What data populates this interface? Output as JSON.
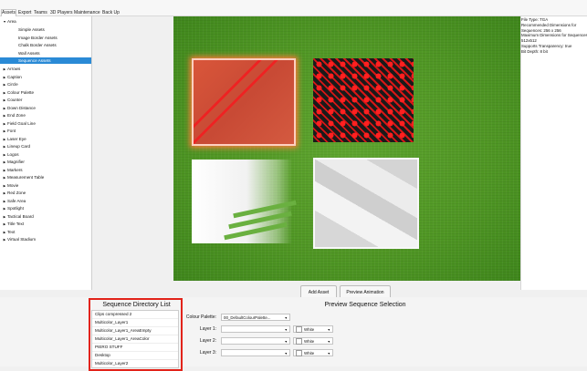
{
  "menu": [
    "Assets",
    "Export",
    "Teams",
    "3D Players",
    "Maintenance",
    "Back Up"
  ],
  "tree": [
    {
      "label": "Area",
      "expanded": true,
      "level": 0
    },
    {
      "label": "Simple Assets",
      "level": 1
    },
    {
      "label": "Image Border Assets",
      "level": 1
    },
    {
      "label": "Chalk Border Assets",
      "level": 1
    },
    {
      "label": "Wall Assets",
      "level": 1
    },
    {
      "label": "Sequence Assets",
      "level": 1,
      "selected": true
    },
    {
      "label": "Arrows",
      "level": 0
    },
    {
      "label": "Caption",
      "level": 0
    },
    {
      "label": "Circle",
      "level": 0
    },
    {
      "label": "Colour Palette",
      "level": 0
    },
    {
      "label": "Counter",
      "level": 0
    },
    {
      "label": "Down Distance",
      "level": 0
    },
    {
      "label": "End Zone",
      "level": 0
    },
    {
      "label": "Field Goal Line",
      "level": 0
    },
    {
      "label": "Font",
      "level": 0
    },
    {
      "label": "Laser Eye",
      "level": 0
    },
    {
      "label": "Lineup Card",
      "level": 0
    },
    {
      "label": "Logos",
      "level": 0
    },
    {
      "label": "Magnifier",
      "level": 0
    },
    {
      "label": "Markers",
      "level": 0
    },
    {
      "label": "Measurement Table",
      "level": 0
    },
    {
      "label": "Movie",
      "level": 0
    },
    {
      "label": "Red Zone",
      "level": 0
    },
    {
      "label": "Safe Area",
      "level": 0
    },
    {
      "label": "Spotlight",
      "level": 0
    },
    {
      "label": "Tactical Board",
      "level": 0
    },
    {
      "label": "Title Text",
      "level": 0
    },
    {
      "label": "Text",
      "level": 0
    },
    {
      "label": "Virtual Stadium",
      "level": 0
    }
  ],
  "info": [
    "File Type: TGA",
    "Recommended Dimensions for",
    "Sequences: 256 x 256",
    "Maximum Dimensions for Sequences:",
    "512x512",
    "Supports Transparency: true",
    "Bit Depth: 8 bit"
  ],
  "buttons": {
    "add_asset": "Add Asset",
    "preview_animation": "Preview Animation"
  },
  "sequence_list": {
    "title": "Sequence Directory List",
    "items": [
      "Clips compressed 2",
      "Multicolor_Layer1",
      "Multicolor_Layer1_AreaEmpty",
      "Multicolor_Layer1_AreaColor",
      "PIERO STUFF",
      "Desktop",
      "Multicolor_Layer2"
    ]
  },
  "preview_selection": {
    "title": "Preview Sequence Selection",
    "colour_palette_label": "Colour Palette:",
    "colour_palette_value": "00_DefaultColourPalette...",
    "layers": [
      {
        "label": "Layer 1:",
        "color": "White"
      },
      {
        "label": "Layer 2:",
        "color": "White"
      },
      {
        "label": "Layer 3:",
        "color": "White"
      }
    ]
  },
  "icons": {
    "expanded": "triangle-down",
    "collapsed": "triangle-right",
    "dropdown": "chevron-down"
  },
  "colors": {
    "selection": "#2a8ad6",
    "highlight_box": "#e2231a",
    "grass": "#4f9624"
  }
}
